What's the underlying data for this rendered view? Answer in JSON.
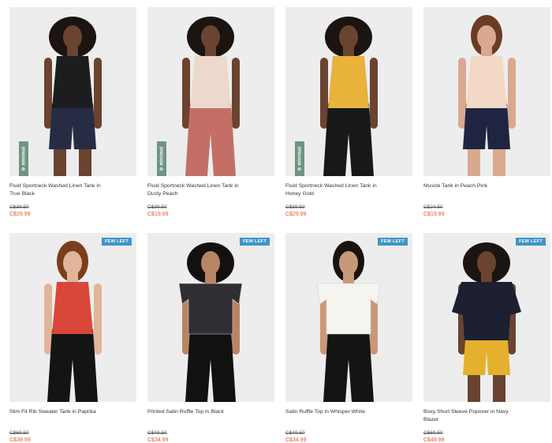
{
  "colors": {
    "sale": "#e1552e",
    "badge": "#3e95c9",
    "minimal_tag": "#6f9583"
  },
  "badges": {
    "few_left": "FEW LEFT",
    "minimal": "⊕ minimal"
  },
  "products": [
    {
      "name": "Fluid Sportneck Washed Linen Tank in True Black",
      "old_price": "C$39.50",
      "price": "C$29.99",
      "top_color": "#1d1d1f",
      "bottom_color": "#272c44",
      "skin": "#6a4331",
      "hair": "#1b1410"
    },
    {
      "name": "Fluid Sportneck Washed Linen Tank in Dusty Peach",
      "old_price": "C$39.50",
      "price": "C$19.99",
      "top_color": "#ecd9cb",
      "bottom_color": "#c46f66",
      "skin": "#6a4331",
      "hair": "#1b1410"
    },
    {
      "name": "Fluid Sportneck Washed Linen Tank in Honey Gold",
      "old_price": "C$39.50",
      "price": "C$29.99",
      "top_color": "#e8b23b",
      "bottom_color": "#18181a",
      "skin": "#6a4331",
      "hair": "#1b1410"
    },
    {
      "name": "Muscle Tank in Peach Pink",
      "old_price": "C$24.50",
      "price": "C$19.99",
      "top_color": "#f3d9c5",
      "bottom_color": "#1f2540",
      "skin": "#d9a98f",
      "hair": "#6b3b23"
    },
    {
      "name": "Slim Fit Rib Sweater Tank in Paprika",
      "old_price": "C$69.50",
      "price": "C$39.99",
      "top_color": "#d9463a",
      "bottom_color": "#141414",
      "skin": "#e0b59a",
      "hair": "#7a3e1d"
    },
    {
      "name": "Printed Satin Ruffle Top in Black",
      "old_price": "C$49.50",
      "price": "C$34.99",
      "top_color": "#2f2f33",
      "bottom_color": "#111111",
      "skin": "#b88466",
      "hair": "#141010"
    },
    {
      "name": "Satin Ruffle Top in Whisper White",
      "old_price": "C$49.50",
      "price": "C$34.99",
      "top_color": "#f6f4ee",
      "bottom_color": "#141414",
      "skin": "#c99879",
      "hair": "#191310"
    },
    {
      "name": "Boxy Short Sleeve Popover in Navy Blazer",
      "old_price": "C$69.50",
      "price": "C$49.99",
      "top_color": "#1d2030",
      "bottom_color": "#e4b02e",
      "skin": "#6a4331",
      "hair": "#1b1410"
    }
  ]
}
